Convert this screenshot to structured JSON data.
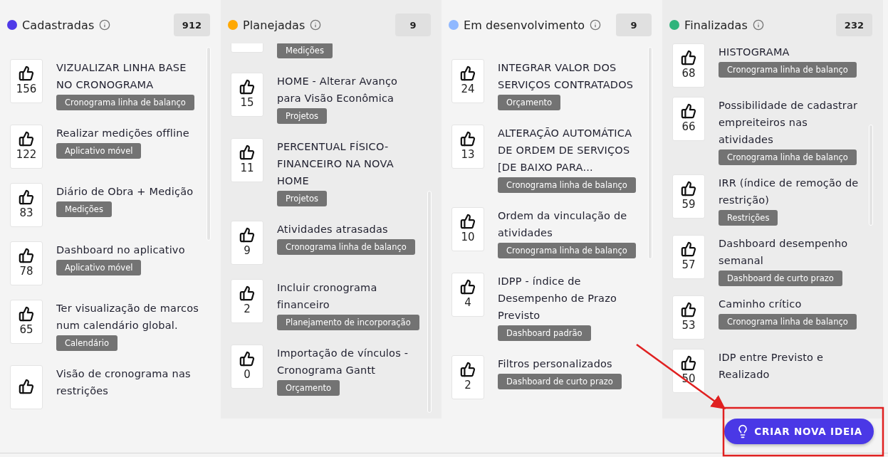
{
  "columns": [
    {
      "title": "Cadastradas",
      "color": "#4f3ae8",
      "count": "912",
      "items": [
        {
          "kind": "full",
          "votes": "156",
          "title": "VIZUALIZAR LINHA BASE NO CRONOGRAMA",
          "tag": "Cronograma linha de balanço"
        },
        {
          "kind": "full",
          "votes": "122",
          "title": "Realizar medições offline",
          "tag": "Aplicativo móvel"
        },
        {
          "kind": "full",
          "votes": "83",
          "title": "Diário de Obra + Medição",
          "tag": "Medições"
        },
        {
          "kind": "full",
          "votes": "78",
          "title": "Dashboard no aplicativo",
          "tag": "Aplicativo móvel"
        },
        {
          "kind": "full",
          "votes": "65",
          "title": "Ter visualização de marcos num calendário global.",
          "tag": "Calendário"
        },
        {
          "kind": "full",
          "title": "Visão de cronograma nas restrições"
        }
      ]
    },
    {
      "title": "Planejadas",
      "color": "#ffa800",
      "count": "9",
      "items": [
        {
          "kind": "partial",
          "tag": "Medições"
        },
        {
          "kind": "full",
          "votes": "15",
          "title": "HOME - Alterar Avanço para Visão Econômica",
          "tag": "Projetos"
        },
        {
          "kind": "full",
          "votes": "11",
          "title": "PERCENTUAL FÍSICO-FINANCEIRO NA NOVA HOME",
          "tag": "Projetos"
        },
        {
          "kind": "full",
          "votes": "9",
          "title": "Atividades atrasadas",
          "tag": "Cronograma linha de balanço"
        },
        {
          "kind": "full",
          "votes": "2",
          "title": "Incluir cronograma financeiro",
          "tag": "Planejamento de incorporação"
        },
        {
          "kind": "full",
          "votes": "0",
          "title": "Importação de vínculos - Cronograma Gantt",
          "tag": "Orçamento"
        }
      ]
    },
    {
      "title": "Em desenvolvimento",
      "color": "#8fb8ff",
      "count": "9",
      "items": [
        {
          "kind": "full",
          "votes": "24",
          "title": "INTEGRAR VALOR DOS SERVIÇOS CONTRATADOS",
          "tag": "Orçamento"
        },
        {
          "kind": "full",
          "votes": "13",
          "title": "ALTERAÇÃO AUTOMÁTICA DE ORDEM DE SERVIÇOS [DE BAIXO PARA...",
          "tag": "Cronograma linha de balanço"
        },
        {
          "kind": "full",
          "votes": "10",
          "title": "Ordem da vinculação de atividades",
          "tag": "Cronograma linha de balanço"
        },
        {
          "kind": "full",
          "votes": "4",
          "title": "IDPP - índice de Desempenho de Prazo Previsto",
          "tag": "Dashboard padrão"
        },
        {
          "kind": "full",
          "votes": "2",
          "title": "Filtros personalizados",
          "tag": "Dashboard de curto prazo"
        }
      ]
    },
    {
      "title": "Finalizadas",
      "color": "#2fb47c",
      "count": "232",
      "items": [
        {
          "kind": "full",
          "votes": "68",
          "title": "HISTOGRAMA",
          "tag": "Cronograma linha de balanço"
        },
        {
          "kind": "full",
          "votes": "66",
          "title": "Possibilidade de cadastrar empreiteiros nas atividades",
          "tag": "Cronograma linha de balanço"
        },
        {
          "kind": "full",
          "votes": "59",
          "title": "IRR (índice de remoção de restrição)",
          "tag": "Restrições"
        },
        {
          "kind": "full",
          "votes": "57",
          "title": "Dashboard desempenho semanal",
          "tag": "Dashboard de curto prazo"
        },
        {
          "kind": "full",
          "votes": "53",
          "title": "Caminho crítico",
          "tag": "Cronograma linha de balanço"
        },
        {
          "kind": "full",
          "votes": "50",
          "title": "IDP entre Previsto e Realizado"
        }
      ]
    }
  ],
  "create_button": {
    "label": "CRIAR NOVA IDEIA"
  }
}
